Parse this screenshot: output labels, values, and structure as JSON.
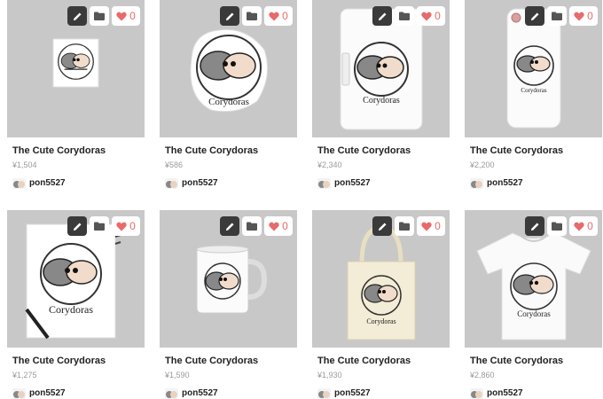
{
  "products": [
    {
      "title": "The Cute Corydoras",
      "price": "¥1,504",
      "user": "pon5527",
      "likes": "0",
      "item": "sticker-square",
      "brand": "Corydoras"
    },
    {
      "title": "The Cute Corydoras",
      "price": "¥586",
      "user": "pon5527",
      "likes": "0",
      "item": "die-cut-sticker",
      "brand": "Corydoras"
    },
    {
      "title": "The Cute Corydoras",
      "price": "¥2,340",
      "user": "pon5527",
      "likes": "0",
      "item": "notebook-phone-case",
      "brand": "Corydoras"
    },
    {
      "title": "The Cute Corydoras",
      "price": "¥2,200",
      "user": "pon5527",
      "likes": "0",
      "item": "iphone-case",
      "brand": "Corydoras"
    },
    {
      "title": "The Cute Corydoras",
      "price": "¥1,275",
      "user": "pon5527",
      "likes": "0",
      "item": "notebook",
      "brand": "Corydoras"
    },
    {
      "title": "The Cute Corydoras",
      "price": "¥1,590",
      "user": "pon5527",
      "likes": "0",
      "item": "mug",
      "brand": ""
    },
    {
      "title": "The Cute Corydoras",
      "price": "¥1,930",
      "user": "pon5527",
      "likes": "0",
      "item": "tote-bag",
      "brand": "Corydoras"
    },
    {
      "title": "The Cute Corydoras",
      "price": "¥2,860",
      "user": "pon5527",
      "likes": "0",
      "item": "t-shirt",
      "brand": "Corydoras"
    }
  ],
  "colors": {
    "thumb_bg": "#c8c8c8",
    "edit_bg": "#3a3a3a",
    "heart": "#e86a6a"
  },
  "icons": {
    "edit": "pencil-icon",
    "folder": "folder-icon",
    "like": "heart-icon",
    "avatar": "fish-avatar-icon"
  }
}
